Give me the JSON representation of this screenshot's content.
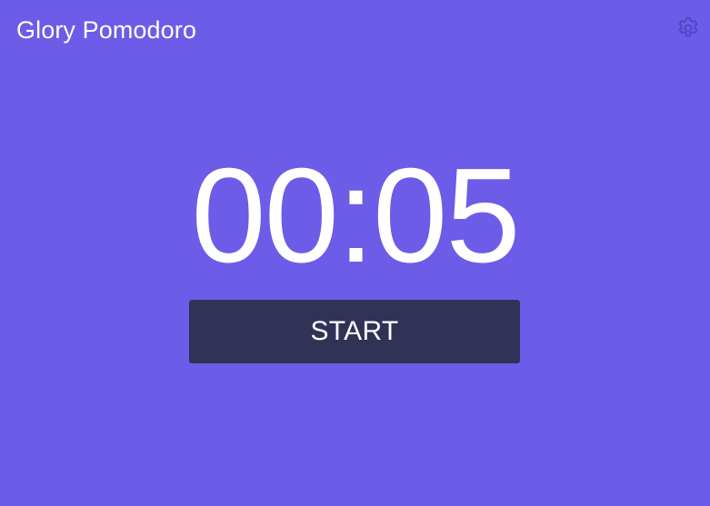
{
  "header": {
    "title": "Glory Pomodoro",
    "settings_icon": "gear-icon"
  },
  "timer": {
    "display": "00:05"
  },
  "controls": {
    "start_label": "START"
  },
  "colors": {
    "background": "#6c5ce7",
    "button": "#303356",
    "text": "#ffffff",
    "icon": "#5a4fc9"
  }
}
